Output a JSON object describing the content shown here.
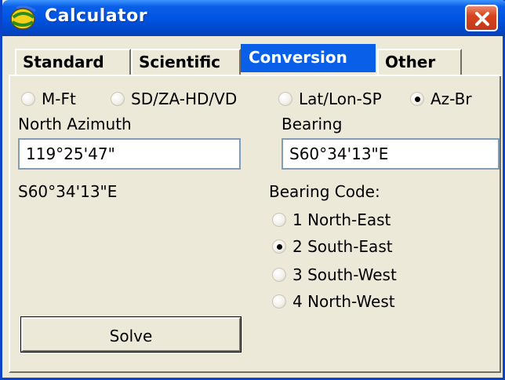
{
  "window": {
    "title": "Calculator"
  },
  "tabs": [
    {
      "label": "Standard"
    },
    {
      "label": "Scientific"
    },
    {
      "label": "Conversion"
    },
    {
      "label": "Other"
    }
  ],
  "active_tab": "Conversion",
  "mode_options": [
    {
      "label": "M-Ft",
      "checked": false
    },
    {
      "label": "SD/ZA-HD/VD",
      "checked": false
    },
    {
      "label": "Lat/Lon-SP",
      "checked": false
    },
    {
      "label": "Az-Br",
      "checked": true
    }
  ],
  "north_azimuth": {
    "label": "North Azimuth",
    "value": "119°25'47\"",
    "result": "S60°34'13\"E"
  },
  "bearing": {
    "label": "Bearing",
    "value": "S60°34'13\"E"
  },
  "bearing_code": {
    "label": "Bearing Code:",
    "options": [
      {
        "label": "1 North-East",
        "checked": false
      },
      {
        "label": "2 South-East",
        "checked": true
      },
      {
        "label": "3 South-West",
        "checked": false
      },
      {
        "label": "4 North-West",
        "checked": false
      }
    ]
  },
  "solve_label": "Solve",
  "colors": {
    "title_bar": "#0054e3",
    "active_tab": "#0a5fe8",
    "close": "#d8431e",
    "background": "#ece9d8"
  },
  "icons": {
    "app": "globe-icon",
    "close": "close-icon"
  }
}
